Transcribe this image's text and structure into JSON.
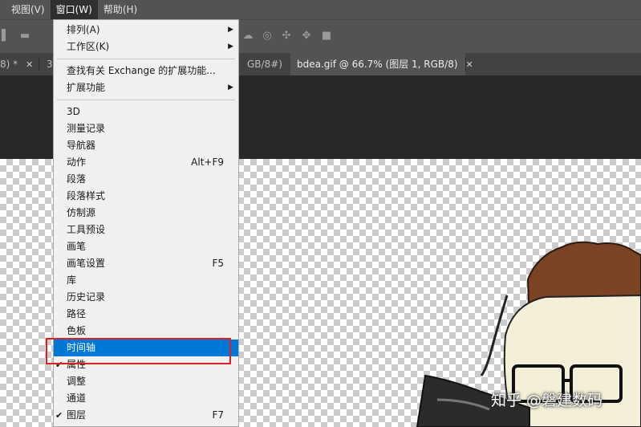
{
  "menubar": {
    "items": [
      "视图(V)",
      "窗口(W)",
      "帮助(H)"
    ],
    "active_index": 1
  },
  "tabs": [
    {
      "label": "8) *"
    },
    {
      "label": "3"
    },
    {
      "label": "GB/8#)"
    },
    {
      "label": "bdea.gif @ 66.7% (图层 1, RGB/8)"
    }
  ],
  "menu": {
    "groups": [
      [
        {
          "label": "排列(A)",
          "submenu": true
        },
        {
          "label": "工作区(K)",
          "submenu": true
        }
      ],
      [
        {
          "label": "查找有关 Exchange 的扩展功能..."
        },
        {
          "label": "扩展功能",
          "submenu": true
        }
      ],
      [
        {
          "label": "3D"
        },
        {
          "label": "测量记录"
        },
        {
          "label": "导航器"
        },
        {
          "label": "动作",
          "shortcut": "Alt+F9"
        },
        {
          "label": "段落"
        },
        {
          "label": "段落样式"
        },
        {
          "label": "仿制源"
        },
        {
          "label": "工具预设"
        },
        {
          "label": "画笔"
        },
        {
          "label": "画笔设置",
          "shortcut": "F5"
        },
        {
          "label": "库"
        },
        {
          "label": "历史记录"
        },
        {
          "label": "路径"
        },
        {
          "label": "色板"
        },
        {
          "label": "时间轴",
          "highlighted": true
        },
        {
          "label": "属性",
          "checked": true
        },
        {
          "label": "调整"
        },
        {
          "label": "通道"
        },
        {
          "label": "图层",
          "shortcut": "F7",
          "checked": true
        }
      ]
    ]
  },
  "watermark": "知乎 @磐建数码",
  "colors": {
    "highlight": "#0078d7",
    "annotation_box": "#e02020",
    "menubar": "#535353"
  }
}
